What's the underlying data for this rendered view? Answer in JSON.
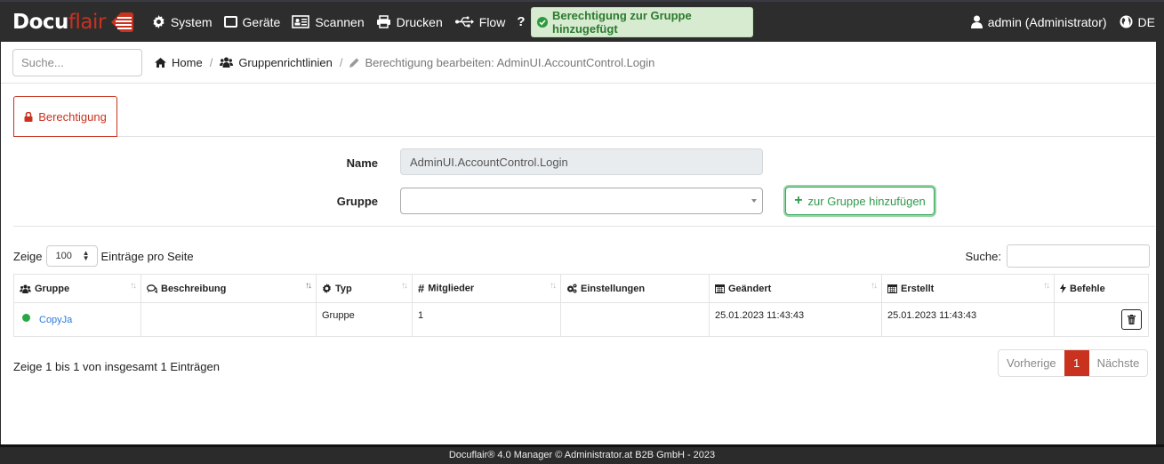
{
  "brand": {
    "part1": "Docu",
    "part2": "flair",
    "accent": "#c8321f"
  },
  "nav": {
    "items": [
      {
        "label": "System",
        "icon": "gear-icon"
      },
      {
        "label": "Geräte",
        "icon": "device-icon"
      },
      {
        "label": "Scannen",
        "icon": "id-card-icon"
      },
      {
        "label": "Drucken",
        "icon": "print-icon"
      },
      {
        "label": "Flow",
        "icon": "usb-icon"
      },
      {
        "label": "Hilfe",
        "icon": "question-icon"
      }
    ],
    "user": "admin (Administrator)",
    "language": "DE"
  },
  "toast": {
    "message": "Berechtigung zur Gruppe hinzugefügt",
    "icon": "check-circle-icon"
  },
  "search": {
    "placeholder": "Suche..."
  },
  "breadcrumb": [
    {
      "label": "Home",
      "icon": "home-icon"
    },
    {
      "label": "Gruppenrichtlinien",
      "icon": "users-icon"
    },
    {
      "label": "Berechtigung bearbeiten: AdminUI.AccountControl.Login",
      "icon": "pencil-icon"
    }
  ],
  "tab": {
    "label": "Berechtigung",
    "icon": "lock-icon"
  },
  "form": {
    "name_label": "Name",
    "name_value": "AdminUI.AccountControl.Login",
    "group_label": "Gruppe",
    "group_value": "",
    "add_button": "zur Gruppe hinzufügen"
  },
  "table_controls": {
    "show_prefix": "Zeige",
    "page_length": "100",
    "show_suffix": "Einträge pro Seite",
    "filter_label": "Suche:",
    "filter_value": ""
  },
  "table": {
    "columns": [
      {
        "label": "Gruppe",
        "icon": "users-icon",
        "sortable": true
      },
      {
        "label": "Beschreibung",
        "icon": "comments-icon",
        "sortable": true
      },
      {
        "label": "Typ",
        "icon": "gear-icon",
        "sortable": true
      },
      {
        "label": "Mitglieder",
        "icon": "hash-icon",
        "sortable": true
      },
      {
        "label": "Einstellungen",
        "icon": "gears-icon",
        "sortable": false
      },
      {
        "label": "Geändert",
        "icon": "calendar-icon",
        "sortable": true
      },
      {
        "label": "Erstellt",
        "icon": "calendar-icon",
        "sortable": true
      },
      {
        "label": "Befehle",
        "icon": "bolt-icon",
        "sortable": false
      }
    ],
    "rows": [
      {
        "gruppe": "CopyJa",
        "status_color": "#28a745",
        "beschreibung": "",
        "typ": "Gruppe",
        "mitglieder": "1",
        "einstellungen": "",
        "geaendert": "25.01.2023 11:43:43",
        "erstellt": "25.01.2023 11:43:43"
      }
    ]
  },
  "info": "Zeige 1 bis 1 von insgesamt 1 Einträgen",
  "pagination": {
    "prev": "Vorherige",
    "current": "1",
    "next": "Nächste"
  },
  "footer": "Docuflair® 4.0 Manager © Administrator.at B2B GmbH - 2023"
}
